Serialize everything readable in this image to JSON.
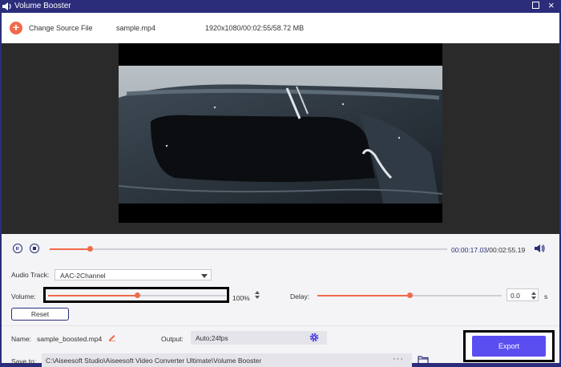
{
  "window": {
    "title": "Volume Booster"
  },
  "toolbar": {
    "change_source_label": "Change Source File",
    "file_name": "sample.mp4",
    "file_info": "1920x1080/00:02:55/58.72 MB"
  },
  "player": {
    "current_time": "00:00:17.03",
    "total_time": "/00:02:55.19",
    "progress": 0.1
  },
  "audio": {
    "track_label": "Audio Track:",
    "track_value": "AAC-2Channel",
    "volume_label": "Volume:",
    "volume_percent": "100%",
    "volume_level": 0.5,
    "delay_label": "Delay:",
    "delay_value": "0.0",
    "delay_unit": "s",
    "delay_level": 0.5,
    "reset_label": "Reset"
  },
  "output": {
    "name_label": "Name:",
    "name_value": "sample_boosted.mp4",
    "output_label": "Output:",
    "output_value": "Auto;24fps",
    "save_label": "Save to:",
    "save_path": "C:\\Aiseesoft Studio\\Aiseesoft Video Converter Ultimate\\Volume Booster",
    "browse_label": "···",
    "export_label": "Export"
  },
  "colors": {
    "accent": "#f06a4a",
    "primary": "#5b4ef0",
    "frame": "#2b2d7a"
  }
}
